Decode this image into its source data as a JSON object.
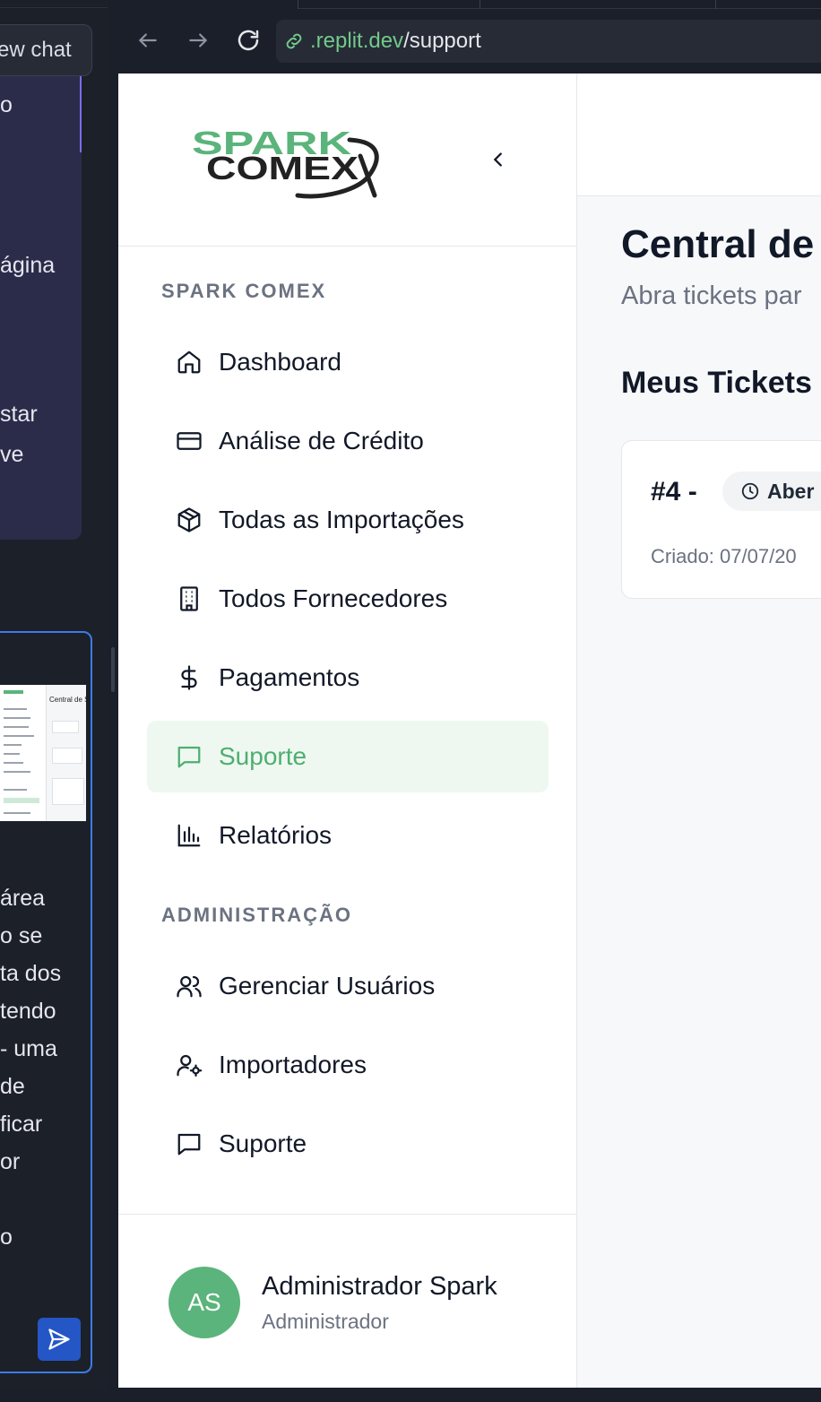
{
  "chat": {
    "new_chat_label": "ew chat",
    "message_lines": [
      "o",
      "ágina",
      "star",
      "ve"
    ],
    "thumbnail_title": "Central de S",
    "input_lines": [
      "área",
      "o se",
      "ta dos",
      "tendo",
      "- uma",
      "de",
      "ficar",
      "or",
      "o"
    ]
  },
  "browser": {
    "url_host": ".replit.dev",
    "url_path": "/support"
  },
  "logo": {
    "line1": "SPARK",
    "line2": "COMEX"
  },
  "sidebar": {
    "section1": "SPARK COMEX",
    "items": [
      {
        "label": "Dashboard",
        "icon": "home-icon"
      },
      {
        "label": "Análise de Crédito",
        "icon": "credit-card-icon"
      },
      {
        "label": "Todas as Importações",
        "icon": "package-icon"
      },
      {
        "label": "Todos Fornecedores",
        "icon": "building-icon"
      },
      {
        "label": "Pagamentos",
        "icon": "dollar-icon"
      },
      {
        "label": "Suporte",
        "icon": "message-icon",
        "active": true
      },
      {
        "label": "Relatórios",
        "icon": "bar-chart-icon"
      }
    ],
    "section2": "ADMINISTRAÇÃO",
    "admin_items": [
      {
        "label": "Gerenciar Usuários",
        "icon": "users-icon"
      },
      {
        "label": "Importadores",
        "icon": "user-cog-icon"
      },
      {
        "label": "Suporte",
        "icon": "message-icon"
      }
    ]
  },
  "user": {
    "initials": "AS",
    "name": "Administrador Spark",
    "role": "Administrador"
  },
  "main": {
    "title": "Central de",
    "subtitle": "Abra tickets par",
    "section_title": "Meus Tickets",
    "ticket": {
      "id": "#4 -",
      "status": "Aber",
      "created": "Criado: 07/07/20"
    }
  },
  "colors": {
    "accent": "#5bb47b",
    "active_bg": "#eef8f1",
    "chat_accent": "#3d7be6"
  }
}
